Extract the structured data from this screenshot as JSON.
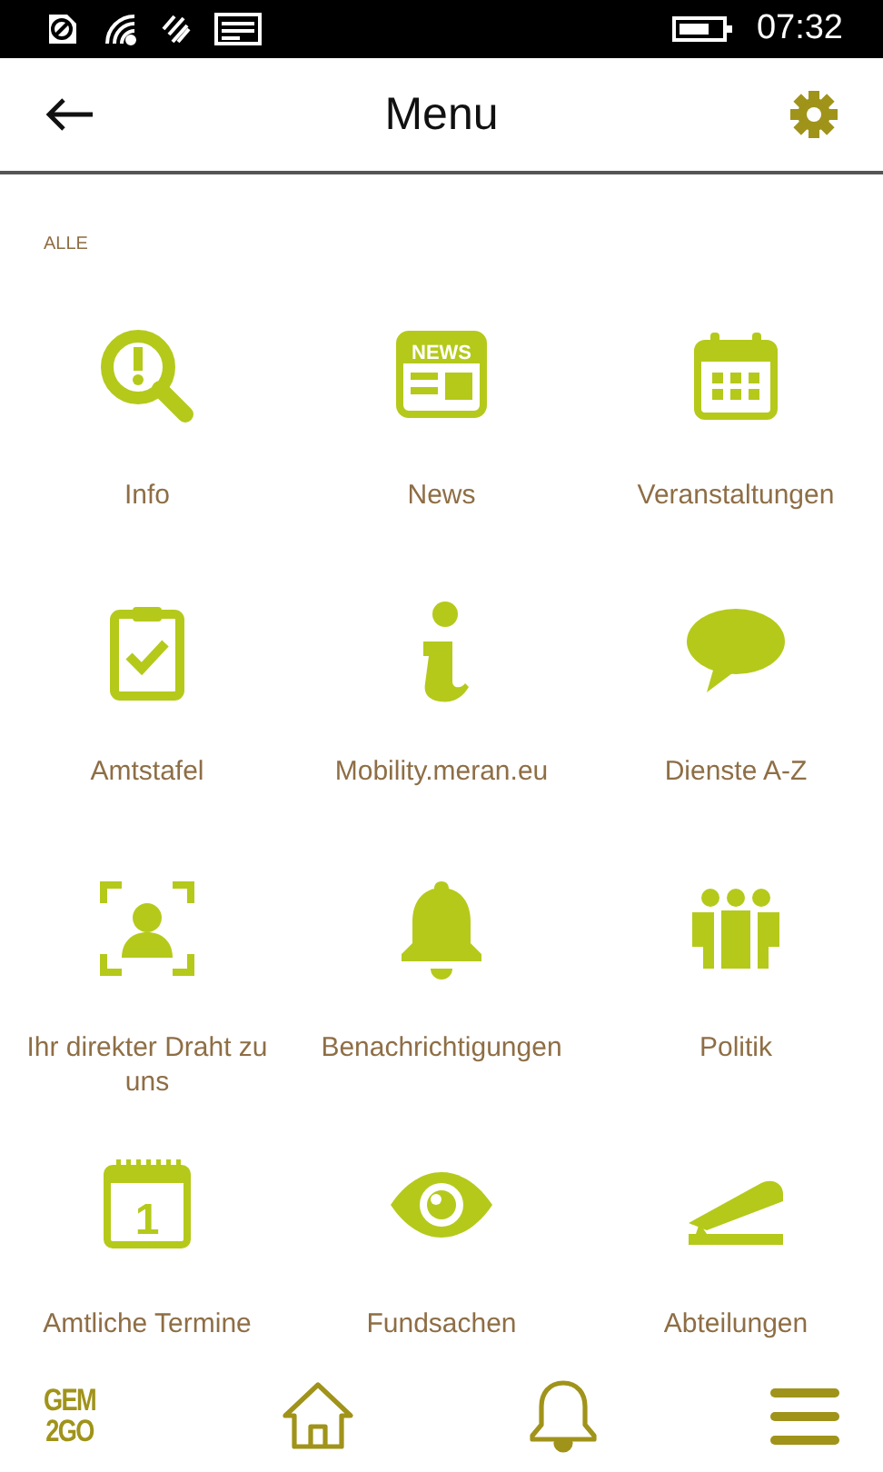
{
  "status_bar": {
    "time": "07:32"
  },
  "header": {
    "title": "Menu"
  },
  "section": {
    "label": "ALLE"
  },
  "items": [
    {
      "label": "Info"
    },
    {
      "label": "News",
      "icon_text": "NEWS"
    },
    {
      "label": "Veranstaltungen"
    },
    {
      "label": "Amtstafel"
    },
    {
      "label": "Mobility.meran.eu"
    },
    {
      "label": "Dienste A-Z"
    },
    {
      "label": "Ihr direkter Draht zu uns"
    },
    {
      "label": "Benachrichtigungen"
    },
    {
      "label": "Politik"
    },
    {
      "label": "Amtliche Termine",
      "icon_text": "1"
    },
    {
      "label": "Fundsachen"
    },
    {
      "label": "Abteilungen"
    }
  ],
  "bottom_nav": {
    "logo": [
      "GEM",
      "2GO"
    ]
  }
}
